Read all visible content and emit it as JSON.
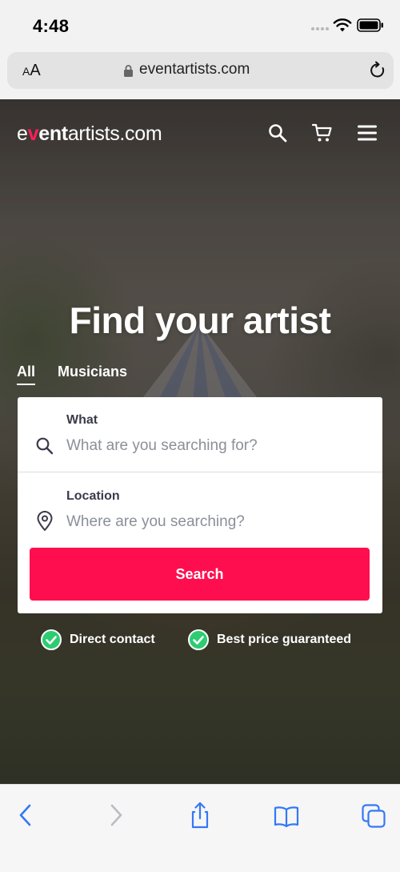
{
  "status_bar": {
    "time": "4:48"
  },
  "address_bar": {
    "text_size_small": "A",
    "text_size_large": "A",
    "url": "eventartists.com"
  },
  "site": {
    "logo": {
      "part1": "e",
      "part2": "v",
      "part3": "ent",
      "part4": "artists.com"
    },
    "icons": {
      "search": "search-icon",
      "cart": "cart-icon",
      "menu": "menu-icon"
    }
  },
  "hero": {
    "title": "Find your artist",
    "tabs": [
      {
        "label": "All",
        "active": true
      },
      {
        "label": "Musicians",
        "active": false
      }
    ],
    "what": {
      "label": "What",
      "placeholder": "What are you searching for?"
    },
    "location": {
      "label": "Location",
      "placeholder": "Where are you searching?"
    },
    "search_button": "Search",
    "benefits": [
      "Direct contact",
      "Best price guaranteed"
    ]
  },
  "colors": {
    "accent": "#ff0e4f",
    "check": "#2ecc71",
    "toolbar_icon": "#3478f6"
  },
  "toolbar": {
    "icons": [
      "back-icon",
      "forward-icon",
      "share-icon",
      "bookmarks-icon",
      "tabs-icon"
    ]
  }
}
